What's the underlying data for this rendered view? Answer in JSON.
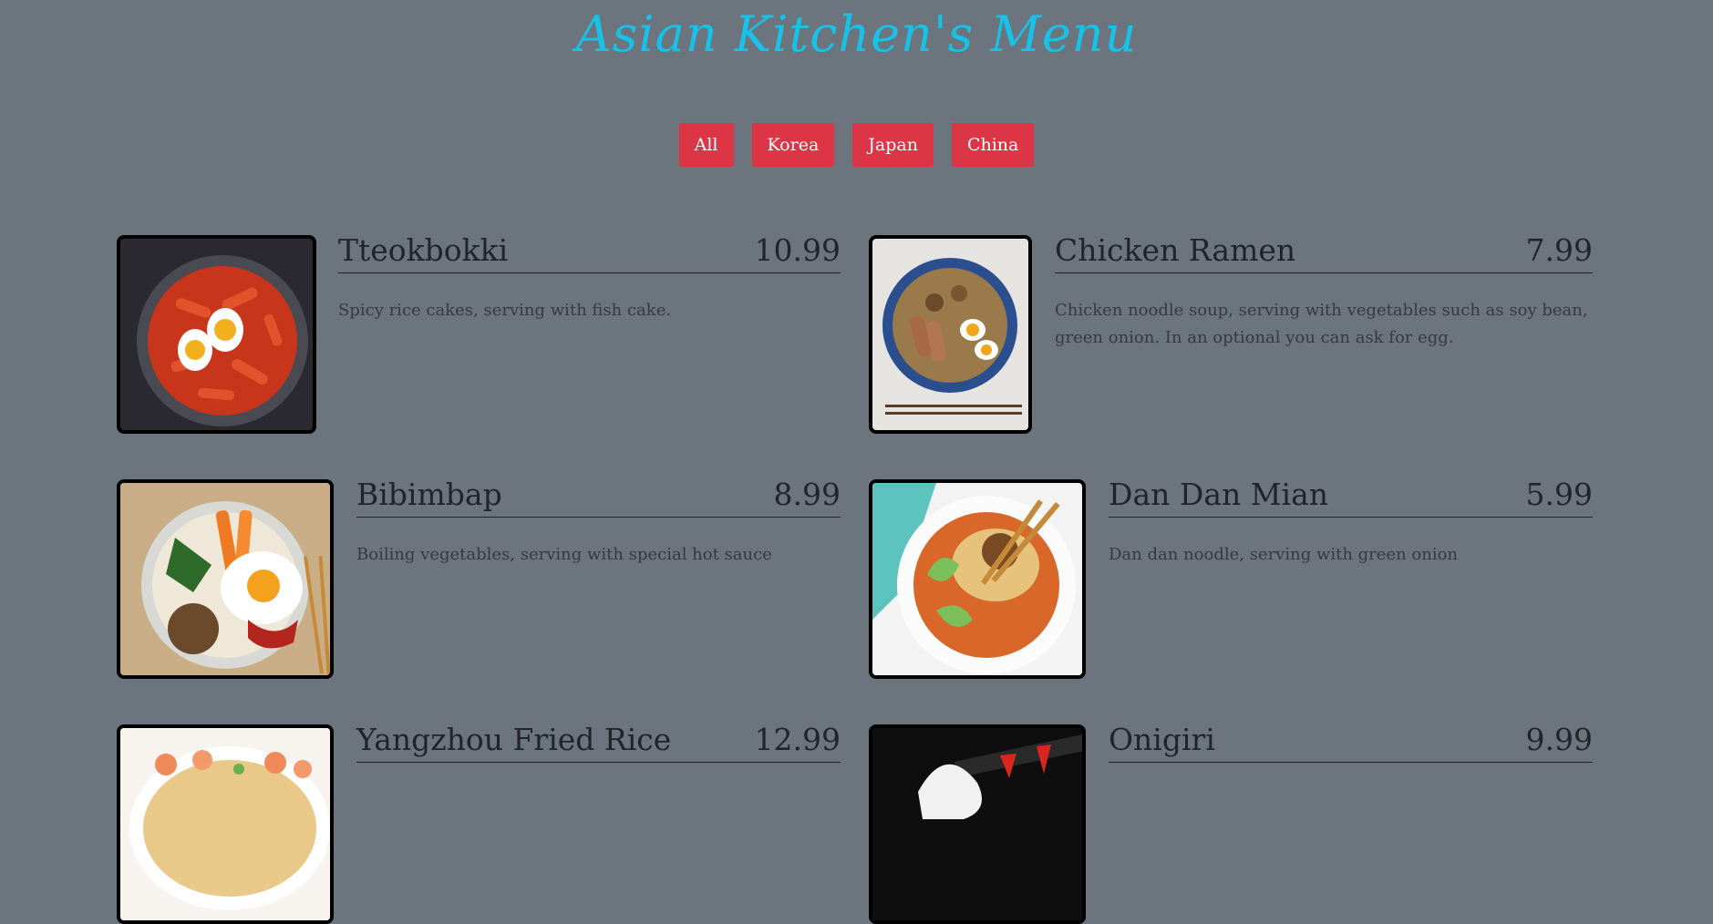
{
  "title": "Asian Kitchen's Menu",
  "filters": [
    "All",
    "Korea",
    "Japan",
    "China"
  ],
  "items": [
    {
      "name": "Tteokbokki",
      "price": "10.99",
      "desc": "Spicy rice cakes, serving with fish cake."
    },
    {
      "name": "Chicken Ramen",
      "price": "7.99",
      "desc": "Chicken noodle soup, serving with vegetables such as soy bean, green onion. In an optional you can ask for egg."
    },
    {
      "name": "Bibimbap",
      "price": "8.99",
      "desc": "Boiling vegetables, serving with special hot sauce"
    },
    {
      "name": "Dan Dan Mian",
      "price": "5.99",
      "desc": "Dan dan noodle, serving with green onion"
    },
    {
      "name": "Yangzhou Fried Rice",
      "price": "12.99",
      "desc": ""
    },
    {
      "name": "Onigiri",
      "price": "9.99",
      "desc": ""
    }
  ],
  "colors": {
    "background": "#6c757d",
    "title": "#17c1e8",
    "button": "#dc3545"
  }
}
